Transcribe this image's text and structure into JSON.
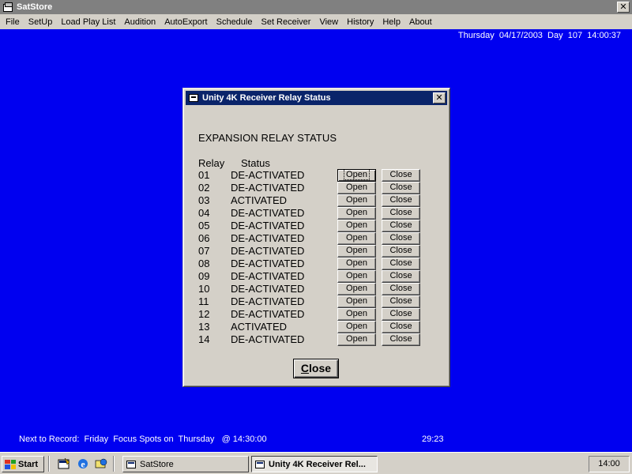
{
  "window": {
    "title": "SatStore",
    "close_glyph": "✕"
  },
  "menu": [
    "File",
    "SetUp",
    "Load Play List",
    "Audition",
    "AutoExport",
    "Schedule",
    "Set Receiver",
    "View",
    "History",
    "Help",
    "About"
  ],
  "datetime": "Thursday  04/17/2003  Day  107  14:00:37",
  "dialog": {
    "title": "Unity 4K Receiver Relay Status",
    "heading": "EXPANSION RELAY STATUS",
    "col_relay": "Relay",
    "col_status": "Status",
    "open_label": "Open",
    "close_label": "Close",
    "close_button_rest": "lose",
    "close_button_accel": "C",
    "relays": [
      {
        "num": "01",
        "status": "DE-ACTIVATED"
      },
      {
        "num": "02",
        "status": "DE-ACTIVATED"
      },
      {
        "num": "03",
        "status": "ACTIVATED"
      },
      {
        "num": "04",
        "status": "DE-ACTIVATED"
      },
      {
        "num": "05",
        "status": "DE-ACTIVATED"
      },
      {
        "num": "06",
        "status": "DE-ACTIVATED"
      },
      {
        "num": "07",
        "status": "DE-ACTIVATED"
      },
      {
        "num": "08",
        "status": "DE-ACTIVATED"
      },
      {
        "num": "09",
        "status": "DE-ACTIVATED"
      },
      {
        "num": "10",
        "status": "DE-ACTIVATED"
      },
      {
        "num": "11",
        "status": "DE-ACTIVATED"
      },
      {
        "num": "12",
        "status": "DE-ACTIVATED"
      },
      {
        "num": "13",
        "status": "ACTIVATED"
      },
      {
        "num": "14",
        "status": "DE-ACTIVATED"
      }
    ]
  },
  "status": {
    "next_record": "Next to Record:  Friday  Focus Spots on  Thursday   @ 14:30:00",
    "countdown": "29:23"
  },
  "taskbar": {
    "start": "Start",
    "tasks": [
      "SatStore",
      "Unity 4K Receiver Rel..."
    ],
    "clock": "14:00"
  },
  "colors": {
    "desktop": "#0000f0",
    "dialog_title": "#0a246a",
    "chrome": "#d4d0c8"
  }
}
